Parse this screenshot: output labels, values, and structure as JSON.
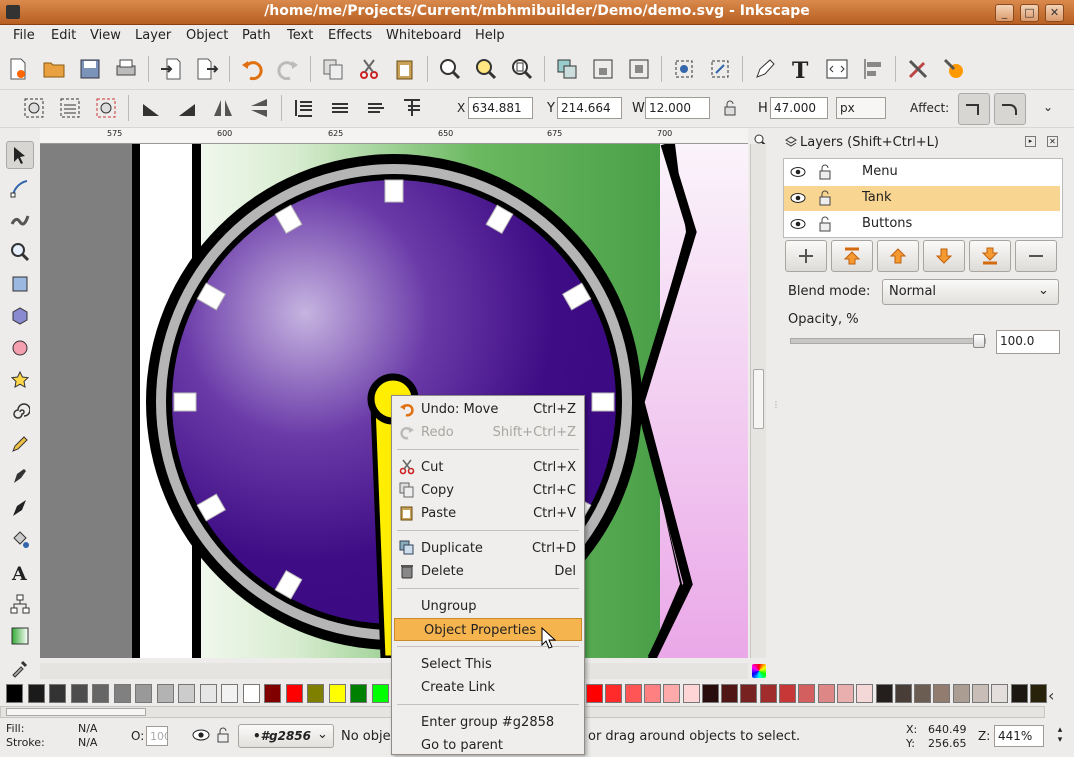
{
  "window": {
    "title": "/home/me/Projects/Current/mbhmibuilder/Demo/demo.svg - Inkscape"
  },
  "menus": [
    "File",
    "Edit",
    "View",
    "Layer",
    "Object",
    "Path",
    "Text",
    "Effects",
    "Whiteboard",
    "Help"
  ],
  "toolbar2": {
    "x_label": "X",
    "x_value": "634.881",
    "y_label": "Y",
    "y_value": "214.664",
    "w_label": "W",
    "w_value": "12.000",
    "h_label": "H",
    "h_value": "47.000",
    "unit": "px",
    "affect_label": "Affect:"
  },
  "ruler": {
    "ticks": [
      "575",
      "600",
      "625",
      "650",
      "675",
      "700"
    ]
  },
  "layers_panel": {
    "title": "Layers (Shift+Ctrl+L)",
    "layers": [
      {
        "name": "Menu",
        "selected": false
      },
      {
        "name": "Tank",
        "selected": true
      },
      {
        "name": "Buttons",
        "selected": false
      }
    ],
    "blend_label": "Blend mode:",
    "blend_value": "Normal",
    "opacity_label": "Opacity, %",
    "opacity_value": "100.0",
    "opacity_level": 1.0
  },
  "context_menu": {
    "items": [
      {
        "label": "Undo: Move",
        "shortcut": "Ctrl+Z",
        "icon": "undo-icon",
        "disabled": false
      },
      {
        "label": "Redo",
        "shortcut": "Shift+Ctrl+Z",
        "icon": "redo-icon",
        "disabled": true
      },
      {
        "sep": true
      },
      {
        "label": "Cut",
        "shortcut": "Ctrl+X",
        "icon": "scissors-icon",
        "disabled": false
      },
      {
        "label": "Copy",
        "shortcut": "Ctrl+C",
        "icon": "copy-icon",
        "disabled": false
      },
      {
        "label": "Paste",
        "shortcut": "Ctrl+V",
        "icon": "paste-icon",
        "disabled": false
      },
      {
        "sep": true
      },
      {
        "label": "Duplicate",
        "shortcut": "Ctrl+D",
        "icon": "duplicate-icon",
        "disabled": false
      },
      {
        "label": "Delete",
        "shortcut": "Del",
        "icon": "trash-icon",
        "disabled": false
      },
      {
        "sep": true
      },
      {
        "label": "Ungroup",
        "shortcut": "",
        "icon": "",
        "disabled": false
      },
      {
        "label": "Object Properties",
        "shortcut": "",
        "icon": "",
        "disabled": false,
        "highlighted": true
      },
      {
        "sep": true
      },
      {
        "label": "Select This",
        "shortcut": "",
        "icon": "",
        "disabled": false
      },
      {
        "label": "Create Link",
        "shortcut": "",
        "icon": "",
        "disabled": false
      },
      {
        "sep": true
      },
      {
        "label": "Enter group #g2858",
        "shortcut": "",
        "icon": "",
        "disabled": false
      },
      {
        "label": "Go to parent",
        "shortcut": "",
        "icon": "",
        "disabled": false
      }
    ]
  },
  "status": {
    "fill_label": "Fill:",
    "fill_value": "N/A",
    "stroke_label": "Stroke:",
    "stroke_value": "N/A",
    "opacity_label": "O:",
    "opacity_value": "100",
    "layer_name": "•#g2856",
    "message_left": "No obje",
    "message_right": "or drag around objects to select.",
    "x_label": "X:",
    "x_value": "640.49",
    "y_label": "Y:",
    "y_value": "256.65",
    "zoom_label": "Z:",
    "zoom_value": "441%"
  },
  "palette": [
    "#000000",
    "#1a1a1a",
    "#333333",
    "#4d4d4d",
    "#666666",
    "#808080",
    "#999999",
    "#b3b3b3",
    "#cccccc",
    "#e6e6e6",
    "#f2f2f2",
    "#ffffff",
    "#800000",
    "#ff0000",
    "#808000",
    "#ffff00",
    "#008000",
    "#00ff00"
  ],
  "palette_right": [
    "#ff0000",
    "#ff2a2a",
    "#ff5555",
    "#ff8080",
    "#ffaaaa",
    "#ffd5d5",
    "#280b0b",
    "#501616",
    "#782121",
    "#a02c2c",
    "#c83737",
    "#d35f5f",
    "#de8787",
    "#e9afaf",
    "#f4d7d7",
    "#241f1c",
    "#483e37",
    "#6c5d53",
    "#917c6f",
    "#ac9d93",
    "#c8beb7",
    "#e3dedb",
    "#1c1710",
    "#28220b"
  ]
}
